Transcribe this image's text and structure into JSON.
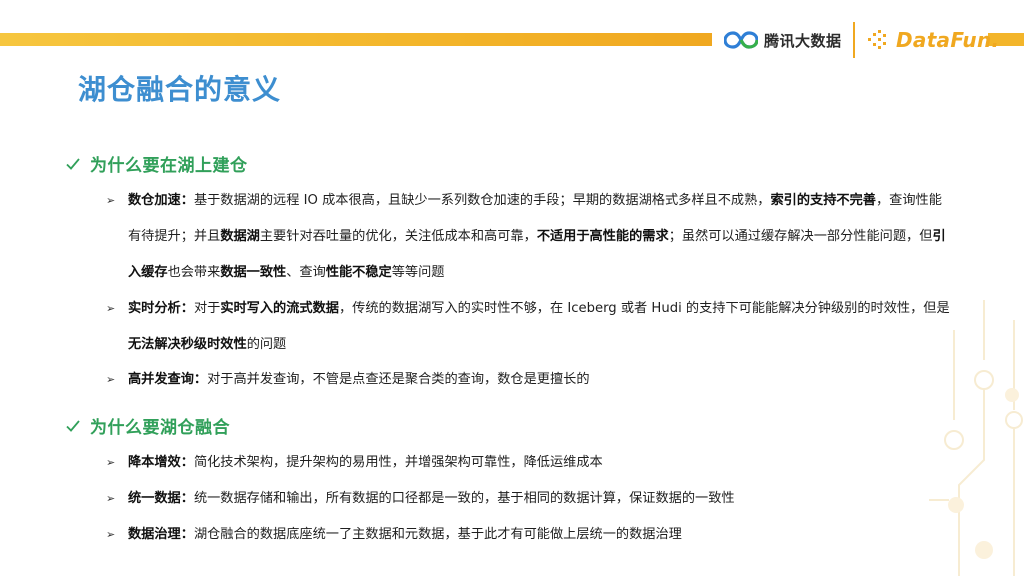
{
  "header": {
    "tencent_name": "腾讯大数据",
    "datafun_name": "DataFun."
  },
  "title": "湖仓融合的意义",
  "sections": [
    {
      "heading": "为什么要在湖上建仓",
      "items": [
        {
          "label": "数仓加速：",
          "segments": [
            {
              "t": "基于数据湖的远程 IO 成本很高，且缺少一系列数仓加速的手段；早期的数据湖格式多样且不成熟，",
              "b": false
            },
            {
              "t": "索引的支持不完善",
              "b": true
            },
            {
              "t": "，查询性能有待提升；并且",
              "b": false
            },
            {
              "t": "数据湖",
              "b": true
            },
            {
              "t": "主要针对吞吐量的优化，关注低成本和高可靠，",
              "b": false
            },
            {
              "t": "不适用于高性能的需求",
              "b": true
            },
            {
              "t": "；虽然可以通过缓存解决一部分性能问题，但",
              "b": false
            },
            {
              "t": "引入缓存",
              "b": true
            },
            {
              "t": "也会带来",
              "b": false
            },
            {
              "t": "数据一致性",
              "b": true
            },
            {
              "t": "、查询",
              "b": false
            },
            {
              "t": "性能不稳定",
              "b": true
            },
            {
              "t": "等等问题",
              "b": false
            }
          ]
        },
        {
          "label": "实时分析：",
          "segments": [
            {
              "t": "对于",
              "b": false
            },
            {
              "t": "实时写入的流式数据",
              "b": true
            },
            {
              "t": "，传统的数据湖写入的实时性不够，在 Iceberg 或者 Hudi 的支持下可能能解决分钟级别的时效性，但是",
              "b": false
            },
            {
              "t": "无法解决秒级时效性",
              "b": true
            },
            {
              "t": "的问题",
              "b": false
            }
          ]
        },
        {
          "label": "高并发查询：",
          "segments": [
            {
              "t": "对于高并发查询，不管是点查还是聚合类的查询，数仓是更擅长的",
              "b": false
            }
          ]
        }
      ]
    },
    {
      "heading": "为什么要湖仓融合",
      "items": [
        {
          "label": "降本增效：",
          "segments": [
            {
              "t": "简化技术架构，提升架构的易用性，并增强架构可靠性，降低运维成本",
              "b": false
            }
          ]
        },
        {
          "label": "统一数据：",
          "segments": [
            {
              "t": "统一数据存储和输出，所有数据的口径都是一致的，基于相同的数据计算，保证数据的一致性",
              "b": false
            }
          ]
        },
        {
          "label": "数据治理：",
          "segments": [
            {
              "t": "湖仓融合的数据底座统一了主数据和元数据，基于此才有可能做上层统一的数据治理",
              "b": false
            }
          ]
        }
      ]
    }
  ],
  "colors": {
    "title": "#3d8ed0",
    "section_heading": "#31a05a",
    "accent_bar": "#f3b52a"
  }
}
